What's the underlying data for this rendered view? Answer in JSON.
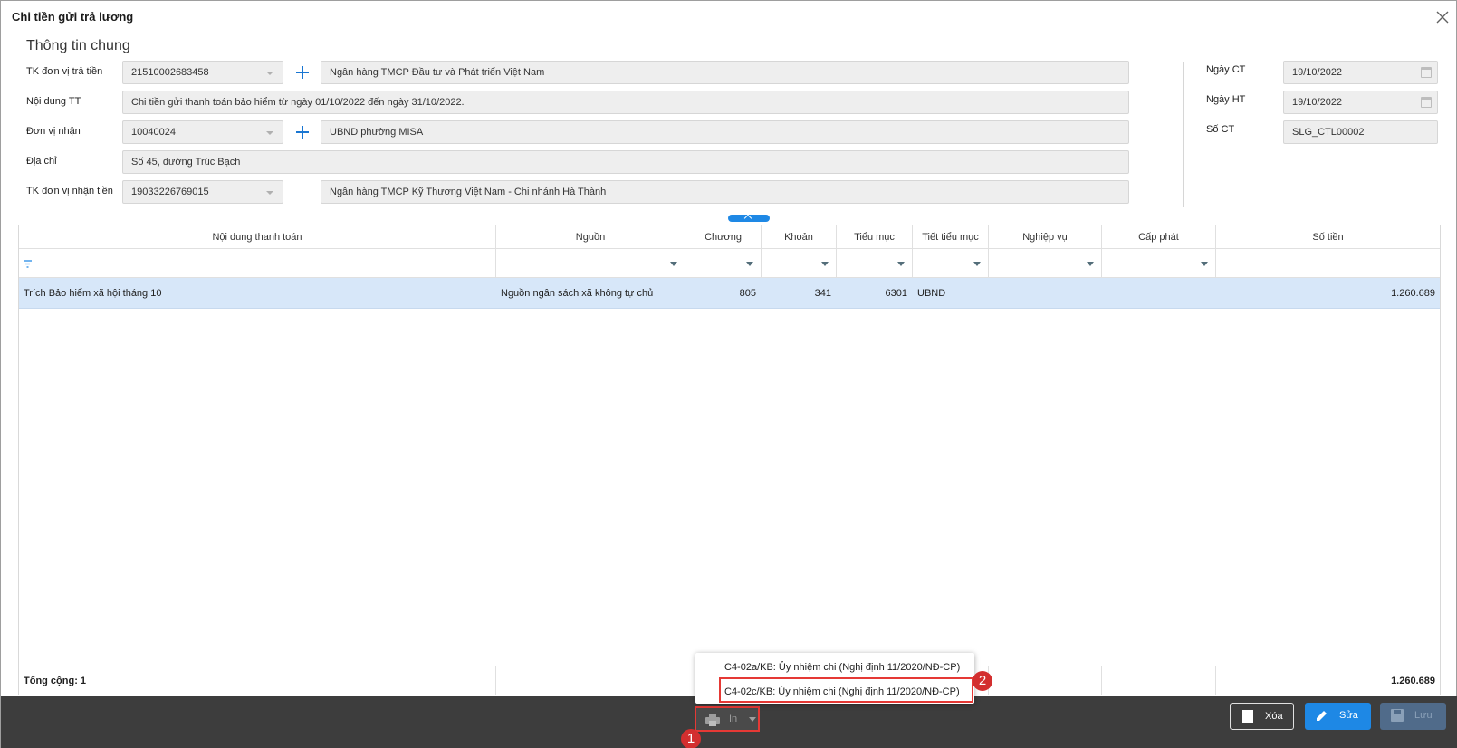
{
  "window": {
    "title": "Chi tiền gửi trả lương"
  },
  "section": {
    "title": "Thông tin chung"
  },
  "form": {
    "payer_account": {
      "label": "TK đơn vị trả tiền",
      "value": "21510002683458",
      "bank": "Ngân hàng TMCP Đầu tư và Phát triển Việt Nam"
    },
    "content": {
      "label": "Nội dung TT",
      "value": "Chi tiền gửi thanh toán bảo hiểm từ ngày 01/10/2022 đến ngày 31/10/2022."
    },
    "receiver": {
      "label": "Đơn vị nhận",
      "value": "10040024",
      "name": "UBND phường MISA"
    },
    "address": {
      "label": "Địa chỉ",
      "value": "Số 45, đường Trúc Bạch"
    },
    "receiver_account": {
      "label": "TK đơn vị nhận tiền",
      "value": "19033226769015",
      "bank": "Ngân hàng TMCP Kỹ Thương Việt Nam - Chi nhánh Hà Thành"
    },
    "doc_date": {
      "label": "Ngày CT",
      "value": "19/10/2022"
    },
    "post_date": {
      "label": "Ngày HT",
      "value": "19/10/2022"
    },
    "doc_no": {
      "label": "Số CT",
      "value": "SLG_CTL00002"
    }
  },
  "grid": {
    "columns": [
      "Nội dung thanh toán",
      "Nguồn",
      "Chương",
      "Khoản",
      "Tiểu mục",
      "Tiết tiểu mục",
      "Nghiệp vụ",
      "Cấp phát",
      "Số tiền"
    ],
    "rows": [
      {
        "content": "Trích Bảo hiểm xã hội tháng 10",
        "source": "Nguồn ngân sách xã không tự chủ",
        "chapter": "805",
        "section": "341",
        "sub_item": "6301",
        "detail": "UBND",
        "business": "",
        "allocation": "",
        "amount": "1.260.689"
      }
    ],
    "total_label": "Tổng cộng: 1",
    "total_amount": "1.260.689"
  },
  "print_menu": {
    "items": [
      "C4-02a/KB: Ủy nhiệm chi (Nghị định 11/2020/NĐ-CP)",
      "C4-02c/KB: Ủy nhiệm chi (Nghị định 11/2020/NĐ-CP)"
    ]
  },
  "toolbar": {
    "print_label": "In",
    "delete_label": "Xóa",
    "edit_label": "Sửa",
    "save_label": "Lưu"
  },
  "annotations": {
    "step1": "1",
    "step2": "2"
  },
  "colors": {
    "accent": "#1e88e5",
    "highlight_row": "#d7e7f9",
    "marker": "#e53935",
    "footer": "#3d3d3d"
  }
}
